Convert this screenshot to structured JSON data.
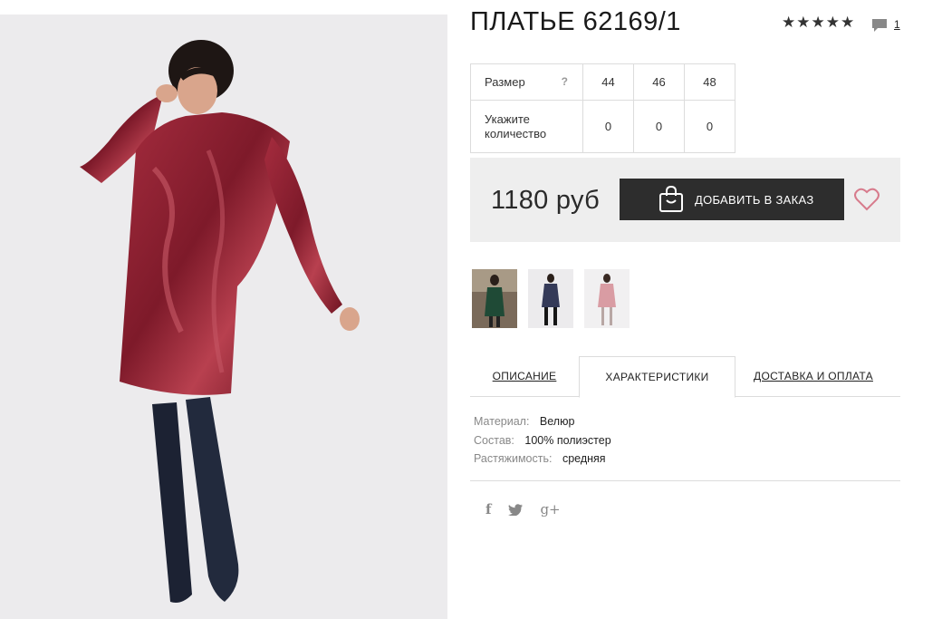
{
  "product": {
    "title": "ПЛАТЬЕ 62169/1",
    "rating_stars": 5,
    "comments_count": "1",
    "photo_alt": "model wearing burgundy velour dress and dark over-knee boots"
  },
  "size_table": {
    "size_label": "Размер",
    "help_glyph": "?",
    "sizes": [
      "44",
      "46",
      "48"
    ],
    "qty_label": "Укажите количество",
    "quantities": [
      "0",
      "0",
      "0"
    ]
  },
  "purchase": {
    "price": "1180 руб",
    "order_button": "ДОБАВИТЬ В ЗАКАЗ"
  },
  "tabs": [
    {
      "label": "ОПИСАНИЕ",
      "active": false
    },
    {
      "label": "ХАРАКТЕРИСТИКИ",
      "active": true
    },
    {
      "label": "ДОСТАВКА И ОПЛАТА",
      "active": false
    }
  ],
  "specs": [
    {
      "key": "Материал:",
      "value": "Велюр"
    },
    {
      "key": "Состав:",
      "value": "100% полиэстер"
    },
    {
      "key": "Растяжимость:",
      "value": "средняя"
    }
  ],
  "social": {
    "facebook": "f",
    "twitter": "twitter-icon",
    "gplus": "g+"
  },
  "colors": {
    "dress": "#8e2232",
    "button_bg": "#2d2d2d",
    "heart": "#d77b8c",
    "panel_bg": "#eeeeee"
  }
}
